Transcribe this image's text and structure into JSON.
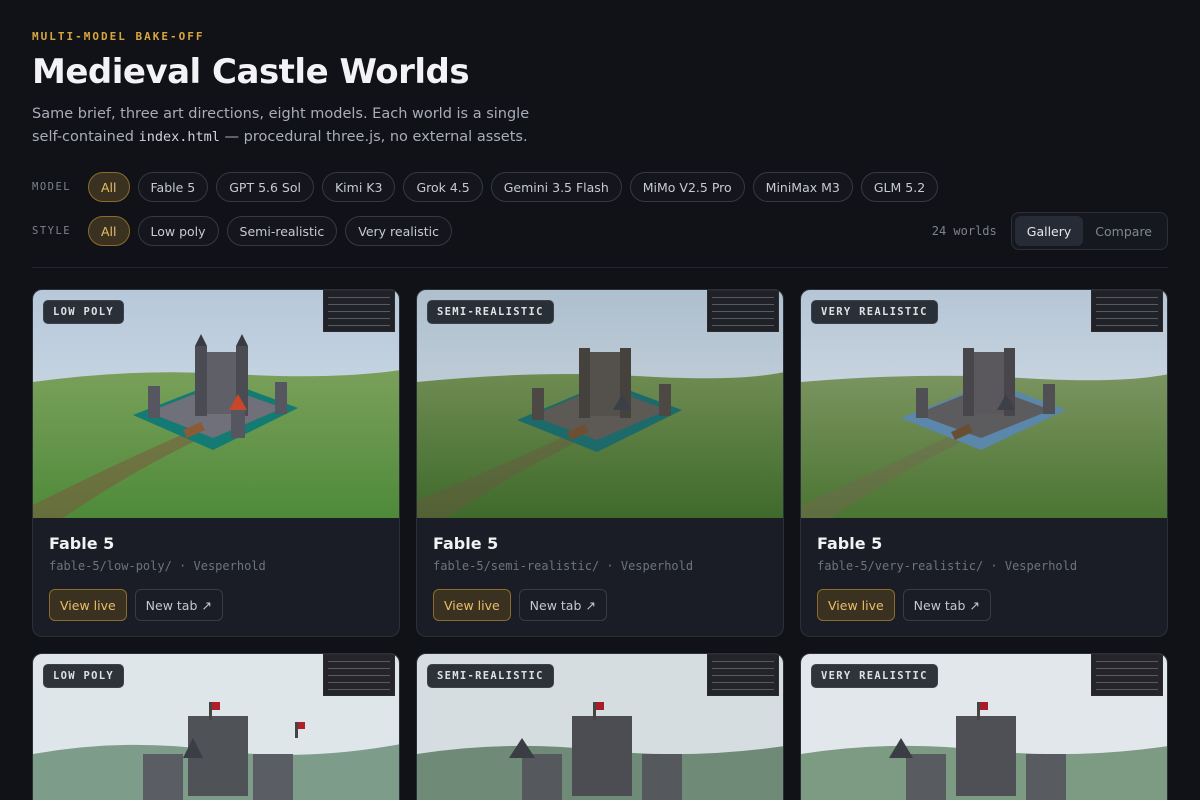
{
  "header": {
    "eyebrow": "MULTI-MODEL BAKE-OFF",
    "title": "Medieval Castle Worlds",
    "subtitle_pre": "Same brief, three art directions, eight models. Each world is a single self-contained ",
    "subtitle_code": "index.html",
    "subtitle_post": " — procedural three.js, no external assets."
  },
  "filters": {
    "model_label": "MODEL",
    "style_label": "STYLE",
    "models": [
      "All",
      "Fable 5",
      "GPT 5.6 Sol",
      "Kimi K3",
      "Grok 4.5",
      "Gemini 3.5 Flash",
      "MiMo V2.5 Pro",
      "MiniMax M3",
      "GLM 5.2"
    ],
    "styles": [
      "All",
      "Low poly",
      "Semi-realistic",
      "Very realistic"
    ],
    "active_model": "All",
    "active_style": "All"
  },
  "view": {
    "count": "24 worlds",
    "gallery": "Gallery",
    "compare": "Compare",
    "active": "Gallery"
  },
  "cards": [
    {
      "badge": "LOW POLY",
      "title": "Fable 5",
      "path": "fable-5/low-poly/ · Vesperhold",
      "view_live": "View live",
      "new_tab": "New tab ↗"
    },
    {
      "badge": "SEMI-REALISTIC",
      "title": "Fable 5",
      "path": "fable-5/semi-realistic/ · Vesperhold",
      "view_live": "View live",
      "new_tab": "New tab ↗"
    },
    {
      "badge": "VERY REALISTIC",
      "title": "Fable 5",
      "path": "fable-5/very-realistic/ · Vesperhold",
      "view_live": "View live",
      "new_tab": "New tab ↗"
    },
    {
      "badge": "LOW POLY"
    },
    {
      "badge": "SEMI-REALISTIC"
    },
    {
      "badge": "VERY REALISTIC"
    }
  ],
  "colors": {
    "accent": "#d6a63e",
    "background": "#101217",
    "card": "#1a1d25"
  }
}
